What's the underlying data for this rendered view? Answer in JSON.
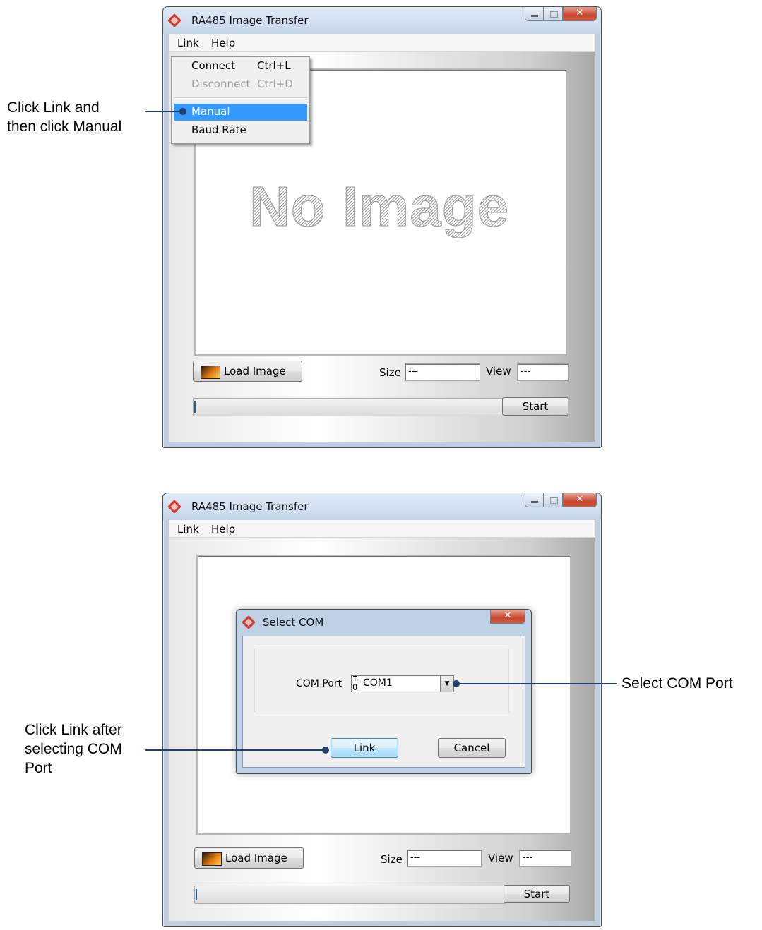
{
  "top_window": {
    "title": "RA485 Image Transfer",
    "menu": [
      "Link",
      "Help"
    ],
    "link_menu": {
      "items": [
        {
          "label": "Connect",
          "shortcut": "Ctrl+L",
          "state": "enabled"
        },
        {
          "label": "Disconnect",
          "shortcut": "Ctrl+D",
          "state": "disabled"
        },
        {
          "label": "Manual",
          "shortcut": "",
          "state": "highlighted"
        },
        {
          "label": "Baud Rate",
          "shortcut": "",
          "state": "enabled"
        }
      ]
    },
    "placeholder_text": "No Image",
    "load_button": "Load Image",
    "size_label": "Size",
    "size_value": "---",
    "view_label": "View",
    "view_value": "---",
    "start_button": "Start"
  },
  "bottom_window": {
    "title": "RA485 Image Transfer",
    "menu": [
      "Link",
      "Help"
    ],
    "load_button": "Load Image",
    "size_label": "Size",
    "size_value": "---",
    "view_label": "View",
    "view_value": "---",
    "start_button": "Start",
    "dialog": {
      "title": "Select COM",
      "com_label": "COM Port",
      "com_glyph": "I/0",
      "com_value": "COM1",
      "link_button": "Link",
      "cancel_button": "Cancel"
    }
  },
  "annotations": {
    "manual": [
      "Click Link and",
      "then click Manual"
    ],
    "link_after": [
      "Click Link after",
      "selecting COM",
      "Port"
    ],
    "select_com": "Select COM Port"
  },
  "colors": {
    "annotation_line": "#1f3f6d",
    "menu_highlight": "#3399ff",
    "close_button": "#c8462d"
  },
  "icons": {
    "app": "app-icon",
    "load_image": "image-icon",
    "com_port": "io-port-icon",
    "dropdown_arrow": "chevron-down-icon"
  }
}
